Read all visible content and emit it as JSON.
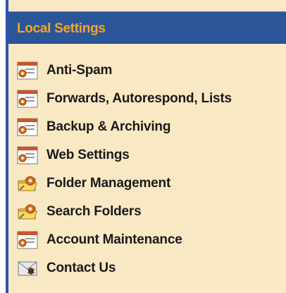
{
  "section": {
    "title": "Local Settings"
  },
  "menu": {
    "items": [
      {
        "label": "Anti-Spam",
        "icon": "settings-window-gear-icon"
      },
      {
        "label": "Forwards, Autorespond, Lists",
        "icon": "settings-window-gear-icon"
      },
      {
        "label": "Backup & Archiving",
        "icon": "settings-window-gear-icon"
      },
      {
        "label": "Web Settings",
        "icon": "settings-window-gear-icon"
      },
      {
        "label": "Folder Management",
        "icon": "folder-gear-icon"
      },
      {
        "label": "Search Folders",
        "icon": "folder-gear-icon"
      },
      {
        "label": "Account Maintenance",
        "icon": "settings-window-gear-icon"
      },
      {
        "label": "Contact Us",
        "icon": "envelope-bug-icon"
      }
    ]
  },
  "colors": {
    "panel_background": "#f9e8c4",
    "header_background": "#2b5599",
    "header_text": "#f4a623",
    "left_border": "#2c54a6"
  }
}
